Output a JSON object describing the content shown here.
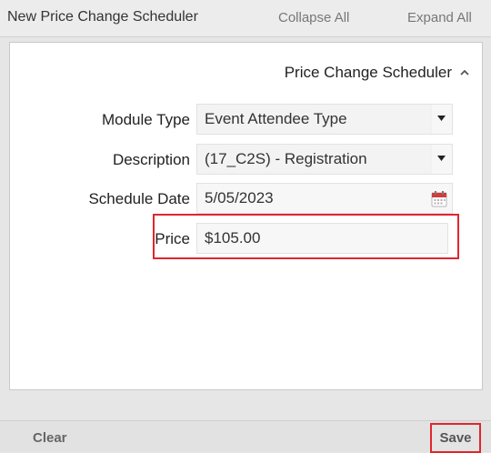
{
  "header": {
    "title": "New Price Change Scheduler",
    "collapse_all": "Collapse All",
    "expand_all": "Expand All"
  },
  "section": {
    "title": "Price Change Scheduler"
  },
  "form": {
    "module_type": {
      "label": "Module Type",
      "value": "Event Attendee Type"
    },
    "description": {
      "label": "Description",
      "value": "(17_C2S) - Registration"
    },
    "schedule_date": {
      "label": "Schedule Date",
      "value": "5/05/2023"
    },
    "price": {
      "label": "Price",
      "value": "$105.00"
    }
  },
  "footer": {
    "clear_label": "Clear",
    "save_label": "Save"
  },
  "colors": {
    "highlight": "#e0262d",
    "calendar": "#d23b3b"
  },
  "icons": [
    "chevron-up-icon",
    "chevron-down-icon",
    "calendar-icon"
  ]
}
